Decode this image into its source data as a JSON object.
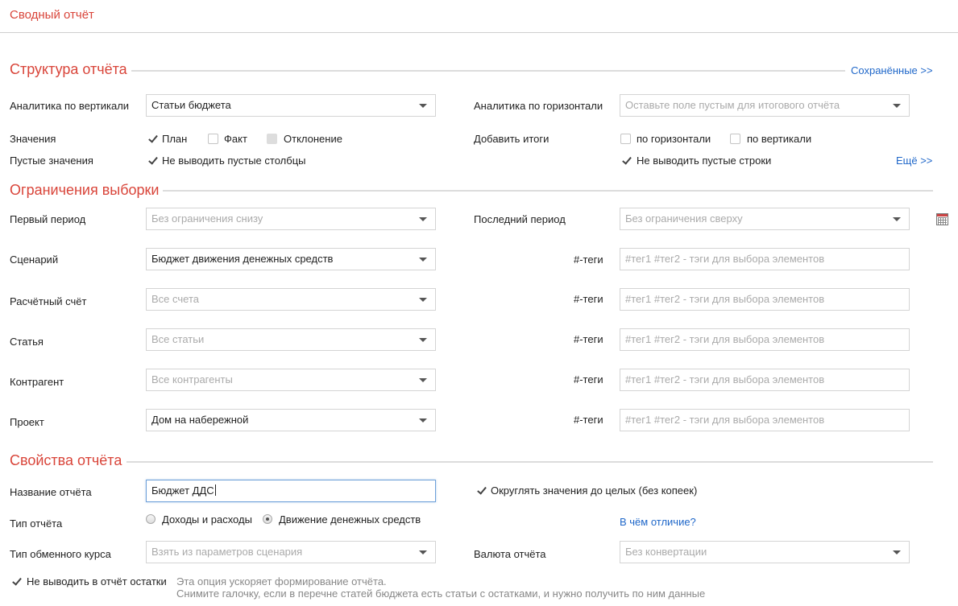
{
  "page": {
    "title": "Сводный отчёт"
  },
  "structure": {
    "title": "Структура отчёта",
    "saved_link": "Сохранённые >>",
    "vertical": {
      "label": "Аналитика по вертикали",
      "value": "Статьи бюджета"
    },
    "horizontal": {
      "label": "Аналитика по горизонтали",
      "placeholder": "Оставьте поле пустым для итогового отчёта"
    },
    "values": {
      "label": "Значения",
      "plan": {
        "label": "План",
        "checked": true
      },
      "fact": {
        "label": "Факт",
        "checked": false
      },
      "deviation": {
        "label": "Отклонение",
        "checked": false,
        "disabled": true
      }
    },
    "totals": {
      "label": "Добавить итоги",
      "horizontal": {
        "label": "по горизонтали",
        "checked": false
      },
      "vertical": {
        "label": "по вертикали",
        "checked": false
      }
    },
    "empty": {
      "label": "Пустые значения",
      "no_empty_columns": {
        "label": "Не выводить пустые столбцы",
        "checked": true
      },
      "no_empty_rows": {
        "label": "Не выводить пустые строки",
        "checked": true
      }
    },
    "more_link": "Ещё >>"
  },
  "filters": {
    "title": "Ограничения выборки",
    "first_period": {
      "label": "Первый период",
      "placeholder": "Без ограничения снизу"
    },
    "last_period": {
      "label": "Последний период",
      "placeholder": "Без ограничения сверху"
    },
    "rows": [
      {
        "label": "Сценарий",
        "value": "Бюджет движения денежных средств",
        "tags_label": "#-теги",
        "tags_placeholder": "#тег1 #тег2 - тэги для выбора элементов"
      },
      {
        "label": "Расчётный счёт",
        "value": "Все счета",
        "tags_label": "#-теги",
        "tags_placeholder": "#тег1 #тег2 - тэги для выбора элементов"
      },
      {
        "label": "Статья",
        "value": "Все статьи",
        "tags_label": "#-теги",
        "tags_placeholder": "#тег1 #тег2 - тэги для выбора элементов"
      },
      {
        "label": "Контрагент",
        "value": "Все контрагенты",
        "tags_label": "#-теги",
        "tags_placeholder": "#тег1 #тег2 - тэги для выбора элементов"
      },
      {
        "label": "Проект",
        "value": "Дом на набережной",
        "tags_label": "#-теги",
        "tags_placeholder": "#тег1 #тег2 - тэги для выбора элементов"
      }
    ]
  },
  "properties": {
    "title": "Свойства отчёта",
    "name": {
      "label": "Название отчёта",
      "value": "Бюджет ДДС"
    },
    "round": {
      "label": "Округлять значения до целых (без копеек)",
      "checked": true
    },
    "type": {
      "label": "Тип отчёта",
      "option_income": "Доходы и расходы",
      "option_cashflow": "Движение денежных средств",
      "selected": "Движение денежных средств",
      "diff_link": "В чём отличие?"
    },
    "rate": {
      "label": "Тип обменного курса",
      "placeholder": "Взять из параметров сценария"
    },
    "currency": {
      "label": "Валюта отчёта",
      "placeholder": "Без конвертации"
    },
    "no_balances": {
      "label": "Не выводить в отчёт остатки",
      "checked": true,
      "note_line1": "Эта опция ускоряет формирование отчёта.",
      "note_line2": "Снимите галочку, если в перечне статей бюджета есть статьи с остатками, и нужно получить по ним данные"
    }
  },
  "colors": {
    "accent": "#d9453a",
    "link": "#1f67c9",
    "placeholder": "#aaaaaa"
  }
}
